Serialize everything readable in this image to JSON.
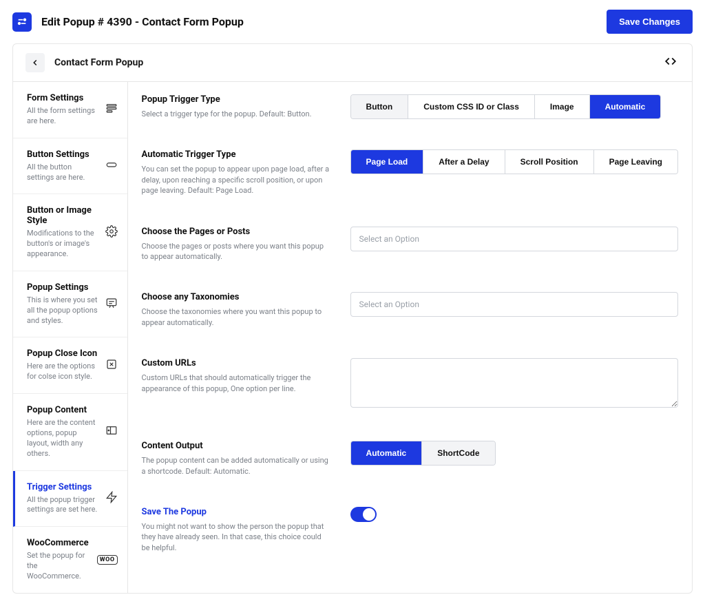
{
  "header": {
    "title": "Edit Popup # 4390 - Contact Form Popup",
    "save_label": "Save Changes"
  },
  "panel": {
    "title": "Contact Form Popup"
  },
  "sidebar": {
    "items": [
      {
        "title": "Form Settings",
        "desc": "All the form settings are here."
      },
      {
        "title": "Button Settings",
        "desc": "All the button settings are here."
      },
      {
        "title": "Button or Image Style",
        "desc": "Modifications to the button's or image's appearance."
      },
      {
        "title": "Popup Settings",
        "desc": "This is where you set all the popup options and styles."
      },
      {
        "title": "Popup Close Icon",
        "desc": "Here are the options for colse icon style."
      },
      {
        "title": "Popup Content",
        "desc": "Here are the content options, popup layout, width any others."
      },
      {
        "title": "Trigger Settings",
        "desc": "All the popup trigger settings are set here."
      },
      {
        "title": "WooCommerce",
        "desc": "Set the popup for the WooCommerce."
      }
    ],
    "woo_badge": "WOO"
  },
  "fields": {
    "trigger_type": {
      "title": "Popup Trigger Type",
      "desc": "Select a trigger type for the popup. Default: Button.",
      "options": [
        "Button",
        "Custom CSS ID or Class",
        "Image",
        "Automatic"
      ],
      "selected": "Automatic"
    },
    "auto_trigger": {
      "title": "Automatic Trigger Type",
      "desc": "You can set the popup to appear upon page load, after a delay, upon reaching a specific scroll position, or upon page leaving. Default: Page Load.",
      "options": [
        "Page Load",
        "After a Delay",
        "Scroll Position",
        "Page Leaving"
      ],
      "selected": "Page Load"
    },
    "pages": {
      "title": "Choose the Pages or Posts",
      "desc": "Choose the pages or posts where you want this popup to appear automatically.",
      "placeholder": "Select an Option"
    },
    "taxonomies": {
      "title": "Choose any Taxonomies",
      "desc": "Choose the taxonomies where you want this popup to appear automatically.",
      "placeholder": "Select an Option"
    },
    "custom_urls": {
      "title": "Custom URLs",
      "desc": "Custom URLs that should automatically trigger the appearance of this popup, One option per line."
    },
    "content_output": {
      "title": "Content Output",
      "desc": "The popup content can be added automatically or using a shortcode. Default: Automatic.",
      "options": [
        "Automatic",
        "ShortCode"
      ],
      "selected": "Automatic"
    },
    "save_popup": {
      "title": "Save The Popup",
      "desc": "You might not want to show the person the popup that they have already seen. In that case, this choice could be helpful.",
      "value": true
    }
  }
}
